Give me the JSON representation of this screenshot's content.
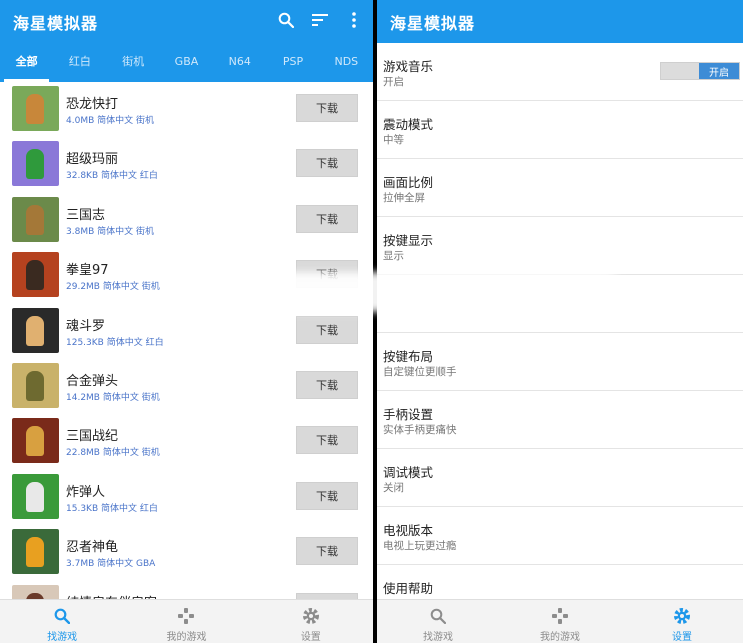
{
  "app": {
    "title": "海星模拟器"
  },
  "left": {
    "tabs": [
      {
        "label": "全部",
        "active": true
      },
      {
        "label": "红白",
        "active": false
      },
      {
        "label": "街机",
        "active": false
      },
      {
        "label": "GBA",
        "active": false
      },
      {
        "label": "N64",
        "active": false
      },
      {
        "label": "PSP",
        "active": false
      },
      {
        "label": "NDS",
        "active": false
      }
    ],
    "games": [
      {
        "name": "恐龙快打",
        "meta": "4.0MB 简体中文 街机",
        "button": "下载",
        "thumb_bg": "#7aa95a",
        "thumb_fg": "#c8873a"
      },
      {
        "name": "超级玛丽",
        "meta": "32.8KB 简体中文 红白",
        "button": "下载",
        "thumb_bg": "#8a78d8",
        "thumb_fg": "#2f9a3c"
      },
      {
        "name": "三国志",
        "meta": "3.8MB 简体中文 街机",
        "button": "下载",
        "thumb_bg": "#6b8a4a",
        "thumb_fg": "#a47838"
      },
      {
        "name": "拳皇97",
        "meta": "29.2MB 简体中文 街机",
        "button": "下载",
        "thumb_bg": "#b5421f",
        "thumb_fg": "#3a2a20"
      },
      {
        "name": "魂斗罗",
        "meta": "125.3KB 简体中文 红白",
        "button": "下载",
        "thumb_bg": "#2a2a2a",
        "thumb_fg": "#e0b070"
      },
      {
        "name": "合金弹头",
        "meta": "14.2MB 简体中文 街机",
        "button": "下载",
        "thumb_bg": "#c9b26a",
        "thumb_fg": "#6e6a30"
      },
      {
        "name": "三国战纪",
        "meta": "22.8MB 简体中文 街机",
        "button": "下载",
        "thumb_bg": "#7a2a1a",
        "thumb_fg": "#d8a040"
      },
      {
        "name": "炸弹人",
        "meta": "15.3KB 简体中文 红白",
        "button": "下载",
        "thumb_bg": "#3a9a3a",
        "thumb_fg": "#e8e8e8"
      },
      {
        "name": "忍者神龟",
        "meta": "3.7MB 简体中文 GBA",
        "button": "下载",
        "thumb_bg": "#3a6a3a",
        "thumb_fg": "#e8a020"
      },
      {
        "name": "纯情房东俏房客",
        "meta": "",
        "button": "下载",
        "thumb_bg": "#d8c8b8",
        "thumb_fg": "#6a3a2a"
      }
    ]
  },
  "right": {
    "settings": [
      {
        "title": "游戏音乐",
        "sub": "开启",
        "toggle": "开启"
      },
      {
        "title": "震动模式",
        "sub": "中等"
      },
      {
        "title": "画面比例",
        "sub": "拉伸全屏"
      },
      {
        "title": "按键显示",
        "sub": "显示"
      },
      {
        "title": "",
        "sub": ""
      },
      {
        "title": "按键布局",
        "sub": "自定键位更顺手"
      },
      {
        "title": "手柄设置",
        "sub": "实体手柄更痛快"
      },
      {
        "title": "调试模式",
        "sub": "关闭"
      },
      {
        "title": "电视版本",
        "sub": "电视上玩更过瘾"
      },
      {
        "title": "使用帮助",
        "sub": ""
      }
    ]
  },
  "bottom_nav": {
    "find": "找游戏",
    "mine": "我的游戏",
    "settings": "设置"
  },
  "colors": {
    "primary": "#1d97ea",
    "meta_text": "#4a74c9",
    "toggle_on": "#3d8cd6"
  },
  "icons": [
    "search-icon",
    "sort-icon",
    "more-icon",
    "gamepad-icon",
    "gear-icon"
  ]
}
